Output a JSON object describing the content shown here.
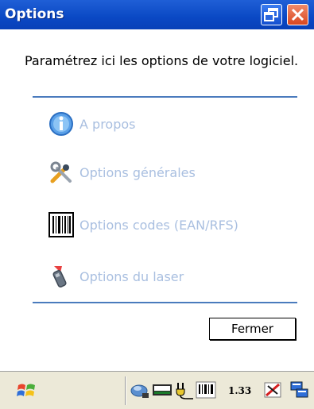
{
  "window": {
    "title": "Options",
    "restore_label": "",
    "close_label": ""
  },
  "content": {
    "prompt": "Paramétrez ici les options de votre logiciel.",
    "options": [
      {
        "label": "A propos",
        "icon": "info-icon"
      },
      {
        "label": "Options générales",
        "icon": "tools-icon"
      },
      {
        "label": "Options codes (EAN/RFS)",
        "icon": "barcode-icon"
      },
      {
        "label": "Options du laser",
        "icon": "laser-scanner-icon"
      }
    ],
    "close_button": "Fermer"
  },
  "taskbar": {
    "clock": "1.33",
    "tray_icons": [
      "network-icon",
      "keyboard-icon",
      "power-icon",
      "barcode-icon",
      "volume-muted-icon",
      "windows-switch-icon"
    ]
  },
  "colors": {
    "titlebar": "#0a48c4",
    "option_text": "#a9bfe0",
    "separator": "#4a7bbd"
  }
}
